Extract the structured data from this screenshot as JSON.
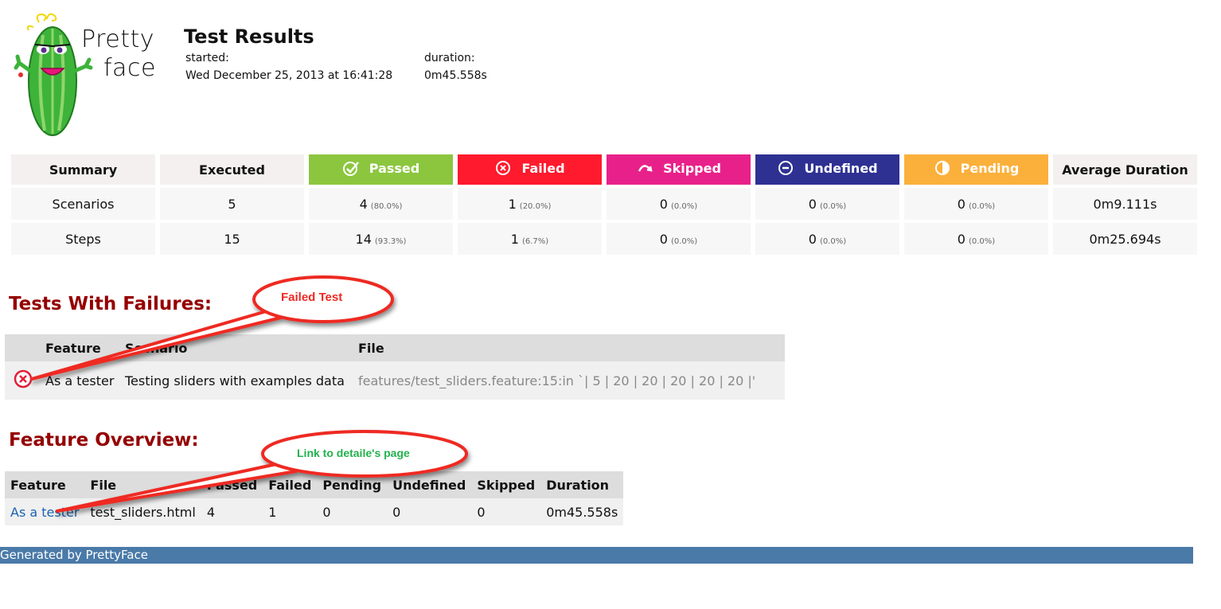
{
  "logo": {
    "line1": "Pretty",
    "line2": "face"
  },
  "header": {
    "title": "Test Results",
    "started_label": "started:",
    "started_value": "Wed December 25, 2013 at 16:41:28",
    "duration_label": "duration:",
    "duration_value": "0m45.558s"
  },
  "summary": {
    "headers": {
      "summary": "Summary",
      "executed": "Executed",
      "passed": "Passed",
      "failed": "Failed",
      "skipped": "Skipped",
      "undefined": "Undefined",
      "pending": "Pending",
      "avg": "Average Duration"
    },
    "colors": {
      "passed": "#8cc63f",
      "failed": "#ff1a2e",
      "skipped": "#e8218a",
      "undefined": "#2e3192",
      "pending": "#fbb03b"
    },
    "icons": {
      "passed": "check-circle-icon",
      "failed": "x-circle-icon",
      "skipped": "skip-arrow-icon",
      "undefined": "minus-circle-icon",
      "pending": "half-circle-icon"
    },
    "rows": [
      {
        "label": "Scenarios",
        "executed": "5",
        "passed": "4",
        "passed_pct": "(80.0%)",
        "failed": "1",
        "failed_pct": "(20.0%)",
        "skipped": "0",
        "skipped_pct": "(0.0%)",
        "undefined": "0",
        "undefined_pct": "(0.0%)",
        "pending": "0",
        "pending_pct": "(0.0%)",
        "avg": "0m9.111s"
      },
      {
        "label": "Steps",
        "executed": "15",
        "passed": "14",
        "passed_pct": "(93.3%)",
        "failed": "1",
        "failed_pct": "(6.7%)",
        "skipped": "0",
        "skipped_pct": "(0.0%)",
        "undefined": "0",
        "undefined_pct": "(0.0%)",
        "pending": "0",
        "pending_pct": "(0.0%)",
        "avg": "0m25.694s"
      }
    ]
  },
  "failures": {
    "title": "Tests With Failures:",
    "headers": {
      "feature": "Feature",
      "scenario": "Scenario",
      "file": "File"
    },
    "rows": [
      {
        "feature": "As a tester",
        "scenario": "Testing sliders with examples data",
        "file": "features/test_sliders.feature:15:in `| 5 | 20 | 20 | 20 | 20 | 20 |'"
      }
    ]
  },
  "overview": {
    "title": "Feature Overview:",
    "headers": {
      "feature": "Feature",
      "file": "File",
      "passed": "Passed",
      "failed": "Failed",
      "pending": "Pending",
      "undefined": "Undefined",
      "skipped": "Skipped",
      "duration": "Duration"
    },
    "rows": [
      {
        "feature": "As a tester",
        "file": "test_sliders.html",
        "passed": "4",
        "failed": "1",
        "pending": "0",
        "undefined": "0",
        "skipped": "0",
        "duration": "0m45.558s"
      }
    ]
  },
  "callouts": {
    "failed_test": "Failed Test",
    "link_detail": "Link to detaile's page"
  },
  "footer": {
    "text": "Generated by PrettyFace"
  }
}
